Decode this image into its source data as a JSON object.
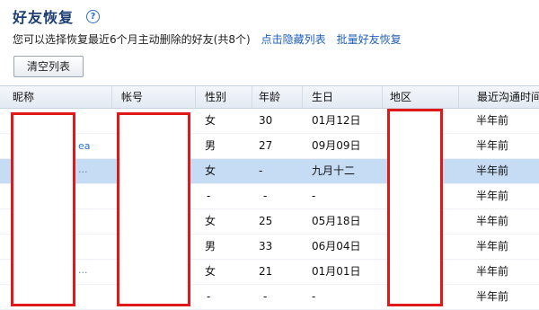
{
  "header": {
    "title": "好友恢复",
    "help_icon": "?"
  },
  "description": {
    "text": "您可以选择恢复最近6个月主动删除的好友(共8个)",
    "hide_list_link": "点击隐藏列表",
    "batch_restore_link": "批量好友恢复"
  },
  "toolbar": {
    "clear_label": "清空列表"
  },
  "table": {
    "columns": [
      "昵称",
      "帐号",
      "性别",
      "年龄",
      "生日",
      "地区",
      "最近沟通时间"
    ],
    "rows": [
      {
        "gender": "女",
        "age": "30",
        "birthday": "01月12日",
        "last": "半年前"
      },
      {
        "nick_fragment": "ea",
        "gender": "男",
        "age": "27",
        "birthday": "09月09日",
        "last": "半年前"
      },
      {
        "nick_fragment": "...",
        "gender": "女",
        "age": "-",
        "birthday": "九月十二",
        "last": "半年前"
      },
      {
        "gender": "-",
        "age": "-",
        "birthday": "-",
        "last": "半年前"
      },
      {
        "gender": "女",
        "age": "25",
        "birthday": "05月18日",
        "last": "半年前"
      },
      {
        "gender": "男",
        "age": "33",
        "birthday": "06月04日",
        "last": "半年前"
      },
      {
        "nick_fragment": "...",
        "gender": "女",
        "age": "21",
        "birthday": "01月01日",
        "last": "半年前"
      },
      {
        "gender": "-",
        "age": "-",
        "birthday": "-",
        "last": "半年前"
      }
    ]
  },
  "colors": {
    "title": "#1e3f73",
    "link": "#1d5fb8",
    "selected_row": "#c6dcf5",
    "redaction": "#e01818"
  }
}
